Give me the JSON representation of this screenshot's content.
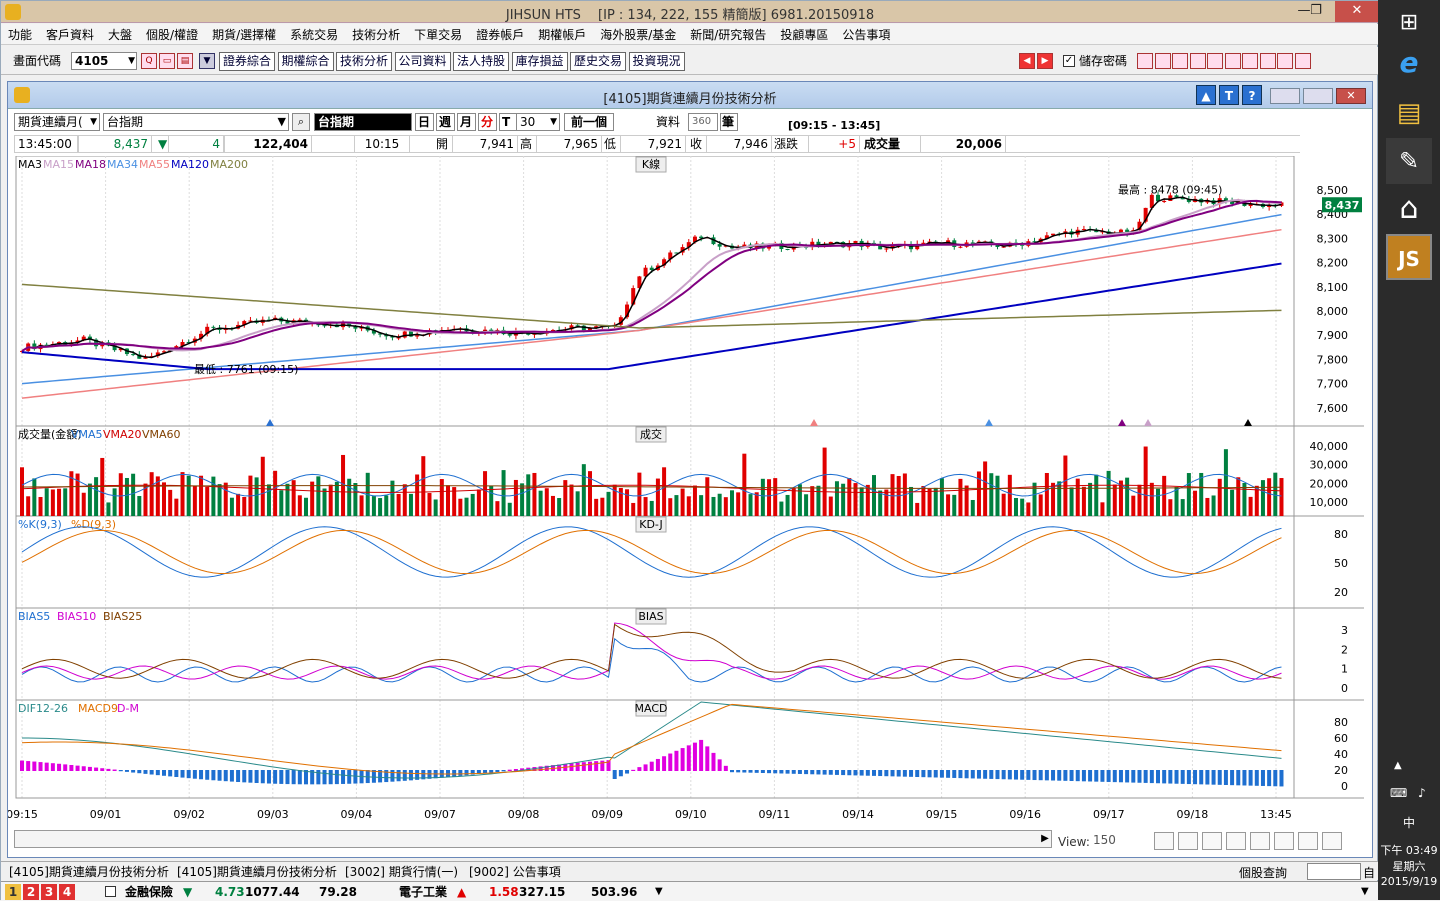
{
  "window": {
    "title": "JIHSUN HTS　 [IP : 134, 222, 155 精簡版] 6981.20150918",
    "minimize": "—",
    "restore": "❐",
    "close": "✕"
  },
  "menu": [
    "功能",
    "客戶資料",
    "大盤",
    "個股/權證",
    "期貨/選擇權",
    "系統交易",
    "技術分析",
    "下單交易",
    "證券帳戶",
    "期權帳戶",
    "海外股票/基金",
    "新聞/研究報告",
    "投顧專區",
    "公告事項"
  ],
  "toolbar": {
    "code_label": "畫面代碼",
    "code_value": "4105",
    "buttons": [
      "證券綜合",
      "期權綜合",
      "技術分析",
      "公司資料",
      "法人持股",
      "庫存損益",
      "歷史交易",
      "投資現況"
    ],
    "save_pwd": "儲存密碼"
  },
  "subwindow": {
    "title": "[4105]期貨連續月份技術分析",
    "help_icons": [
      "▲",
      "T",
      "?"
    ]
  },
  "controls": {
    "product_type": "期貨連續月(",
    "product_name": "台指期",
    "search_value": "台指期",
    "period_buttons": [
      "日",
      "週",
      "月",
      "分",
      "T"
    ],
    "period_active": "分",
    "minutes": "30",
    "prev_label": "前一個",
    "data_label": "資料",
    "data_count": "360",
    "data_unit": "筆",
    "time_range": "[09:15 - 13:45]"
  },
  "quote": {
    "time": "13:45:00",
    "price": "8,437",
    "arrow": "▼",
    "change": "4",
    "volume": "122,404",
    "qtime": "10:15",
    "open_label": "開",
    "open": "7,941",
    "high_label": "高",
    "high": "7,965",
    "low_label": "低",
    "low": "7,921",
    "close_label": "收",
    "close": "7,946",
    "chg_label": "漲跌",
    "chg": "+5",
    "vol_label": "成交量",
    "vol": "20,006"
  },
  "panels": {
    "k": {
      "tag": "K線",
      "legend": [
        {
          "t": "MA3",
          "c": "#000000"
        },
        {
          "t": "MA15",
          "c": "#c8a0c8"
        },
        {
          "t": "MA18",
          "c": "#800080"
        },
        {
          "t": "MA34",
          "c": "#4a90e2"
        },
        {
          "t": "MA55",
          "c": "#f08080"
        },
        {
          "t": "MA120",
          "c": "#0000c0"
        },
        {
          "t": "MA200",
          "c": "#808040"
        }
      ],
      "high_note": "最高 : 8478 (09:45)",
      "low_note": "最低 : 7761 (09:15)",
      "last": "8,437",
      "yticks": [
        "8,500",
        "8,400",
        "8,300",
        "8,200",
        "8,100",
        "8,000",
        "7,900",
        "7,800",
        "7,700",
        "7,600"
      ]
    },
    "vol": {
      "tag": "成交",
      "legend": [
        {
          "t": "成交量(金額)",
          "c": "#000000"
        },
        {
          "t": "VMA5",
          "c": "#1e6fd0"
        },
        {
          "t": "VMA20",
          "c": "#d00000"
        },
        {
          "t": "VMA60",
          "c": "#804000"
        }
      ],
      "yticks": [
        "40,000",
        "30,000",
        "20,000",
        "10,000"
      ]
    },
    "kd": {
      "tag": "KD-J",
      "legend": [
        {
          "t": "%K(9,3)",
          "c": "#1e6fd0"
        },
        {
          "t": "%D(9,3)",
          "c": "#e07000"
        }
      ],
      "yticks": [
        "80",
        "50",
        "20"
      ]
    },
    "bias": {
      "tag": "BIAS",
      "legend": [
        {
          "t": "BIAS5",
          "c": "#1e6fd0"
        },
        {
          "t": "BIAS10",
          "c": "#d000d0"
        },
        {
          "t": "BIAS25",
          "c": "#804000"
        }
      ],
      "yticks": [
        "3",
        "2",
        "1",
        "0"
      ]
    },
    "macd": {
      "tag": "MACD",
      "legend": [
        {
          "t": "DIF12-26",
          "c": "#2a8a8a"
        },
        {
          "t": "MACD9",
          "c": "#e07000"
        },
        {
          "t": "D-M",
          "c": "#d000d0"
        }
      ],
      "yticks": [
        "80",
        "60",
        "40",
        "20",
        "0"
      ]
    }
  },
  "xaxis": [
    "09:15",
    "09/01",
    "09/02",
    "09/03",
    "09/04",
    "09/07",
    "09/08",
    "09/09",
    "09/10",
    "09/11",
    "09/14",
    "09/15",
    "09/16",
    "09/17",
    "09/18",
    "13:45"
  ],
  "view": {
    "label": "View:",
    "value": "150"
  },
  "tabs": [
    "[4105]期貨連續月份技術分析",
    "[4105]期貨連續月份技術分析",
    "[3002] 期貨行情(一)",
    "[9002] 公告事項"
  ],
  "tab_right": "個股查詢",
  "status": {
    "nums": [
      "1",
      "2",
      "3",
      "4"
    ],
    "s1_name": "金融保險",
    "s1_arrow": "▼",
    "s1_chg": "4.73",
    "s1_idx": "1077.44",
    "s1_vol": "79.28",
    "s2_name": "電子工業",
    "s2_arrow": "▲",
    "s2_chg": "1.58",
    "s2_idx": "327.15",
    "s2_vol": "503.96"
  },
  "taskbar": {
    "ime": "中",
    "time": "下午 03:49",
    "weekday": "星期六",
    "date": "2015/9/19"
  },
  "colors": {
    "up": "#e00000",
    "down": "#008040",
    "accent": "#0a246a"
  }
}
